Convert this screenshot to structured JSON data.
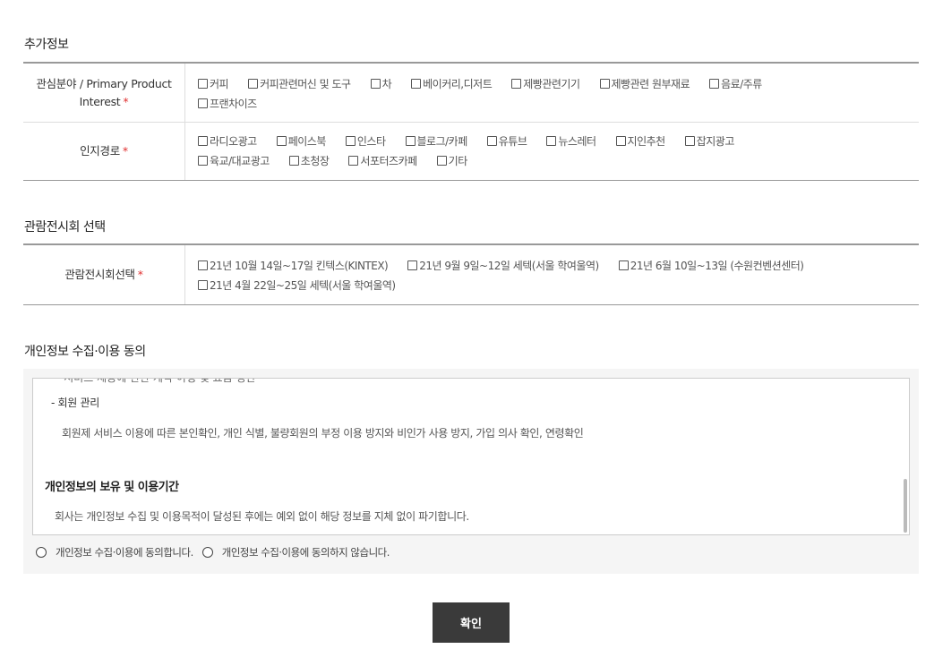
{
  "sections": {
    "additional_info_title": "추가정보",
    "exhibition_title": "관람전시회 선택",
    "privacy_title": "개인정보 수집·이용 동의"
  },
  "interest": {
    "label_line1": "관심분야 / Primary Product",
    "label_line2": "Interest",
    "required_mark": "*",
    "options": [
      "커피",
      "커피관련머신 및 도구",
      "차",
      "베이커리,디저트",
      "제빵관련기기",
      "제빵관련 원부재료",
      "음료/주류",
      "프랜차이즈"
    ]
  },
  "source": {
    "label": "인지경로",
    "required_mark": "*",
    "options": [
      "라디오광고",
      "페이스북",
      "인스타",
      "블로그/카페",
      "유튜브",
      "뉴스레터",
      "지인추천",
      "잡지광고",
      "육교/대교광고",
      "초청장",
      "서포터즈카페",
      "기타"
    ]
  },
  "exhibition": {
    "label": "관람전시회선택",
    "required_mark": "*",
    "options": [
      "21년 10월 14일~17일 킨텍스(KINTEX)",
      "21년 9월 9일~12일 세텍(서울 학여울역)",
      "21년 6월 10일~13일 (수원컨벤션센터)",
      "21년 4월 22일~25일 세텍(서울 학여울역)"
    ]
  },
  "privacy": {
    "cut_line": "- 서비스 제공에 관한 계약 이행 및 요금 정산",
    "sub_item": "- 회원 관리",
    "member_text": "회원제 서비스 이용에 따른 본인확인, 개인 식별, 불량회원의 부정 이용 방지와 비인가 사용 방지, 가입 의사 확인, 연령확인",
    "retention_heading": "개인정보의 보유 및 이용기간",
    "retention_text": "회사는 개인정보 수집 및 이용목적이 달성된 후에는 예외 없이 해당 정보를 지체 없이 파기합니다.",
    "agree_label": "개인정보 수집·이용에 동의합니다.",
    "disagree_label": "개인정보 수집·이용에 동의하지 않습니다."
  },
  "confirm_label": "확인"
}
